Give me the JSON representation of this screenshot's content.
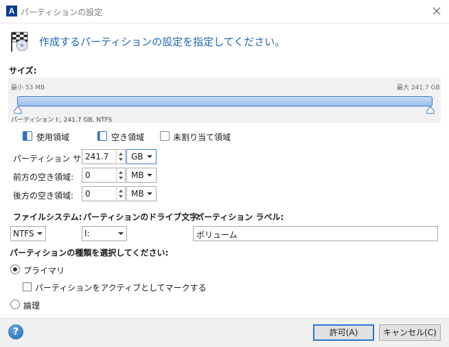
{
  "window": {
    "title": "パーティションの設定",
    "logo_letter": "A"
  },
  "header": {
    "text": "作成するパーティションの設定を指定してください。"
  },
  "size_section": {
    "label": "サイズ:",
    "min_label": "最小 53 MB",
    "max_label": "最大 241.7 GB",
    "partition_info": "パーティション I:, 241.7 GB, NTFS"
  },
  "legend": {
    "used": "使用領域",
    "free": "空き領域",
    "unallocated": "未割り当て領域"
  },
  "fields": {
    "partition_size": {
      "label": "パーティション サイズ:",
      "value": "241.7",
      "unit": "GB"
    },
    "free_before": {
      "label": "前方の空き領域:",
      "value": "0",
      "unit": "MB"
    },
    "free_after": {
      "label": "後方の空き領域:",
      "value": "0",
      "unit": "MB"
    }
  },
  "filesystem": {
    "label": "ファイルシステム:",
    "value": "NTFS"
  },
  "drive_letter": {
    "label": "パーティションのドライブ文字:",
    "value": "I:"
  },
  "partition_label": {
    "label": "パーティション ラベル:",
    "value": "ボリューム"
  },
  "partition_type": {
    "label": "パーティションの種類を選択してください:",
    "primary": "プライマリ",
    "mark_active": "パーティションをアクティブとしてマークする",
    "logical": "論理",
    "selected": "primary",
    "active_checked": false
  },
  "buttons": {
    "ok": "許可(A)",
    "cancel": "キャンセル(C)",
    "help": "?"
  },
  "colors": {
    "accent": "#1e67b6",
    "slider_fill": "#9dc0ee",
    "slider_border": "#3d79c9"
  }
}
